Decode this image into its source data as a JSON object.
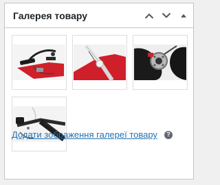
{
  "metabox": {
    "title": "Галерея товару"
  },
  "header_actions": [
    {
      "icon": "chevron-up-icon"
    },
    {
      "icon": "chevron-down-icon"
    },
    {
      "icon": "caret-up-icon"
    }
  ],
  "gallery": {
    "images": [
      {
        "alt": "",
        "subject": "bicycle-handlebar"
      },
      {
        "alt": "",
        "subject": "bicycle-frame-red"
      },
      {
        "alt": "",
        "subject": "bicycle-brake-disc"
      },
      {
        "alt": "",
        "subject": "bicycle-handlebar-grip"
      }
    ]
  },
  "add_link": {
    "label": "Додати зображення галереї товару"
  },
  "help": {
    "glyph": "?"
  },
  "colors": {
    "link": "#2271b1",
    "border": "#c3c4c7",
    "accent_red": "#d0202a"
  }
}
